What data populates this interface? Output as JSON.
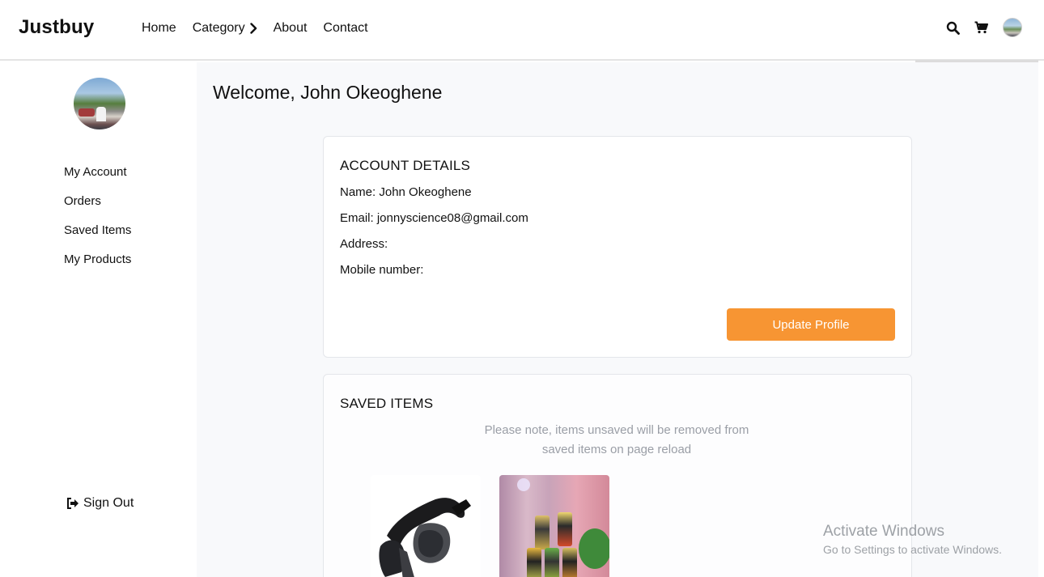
{
  "header": {
    "logo": "Justbuy",
    "nav": [
      {
        "label": "Home"
      },
      {
        "label": "Category"
      },
      {
        "label": "About"
      },
      {
        "label": "Contact"
      }
    ],
    "icons": [
      "search-icon",
      "cart-icon",
      "user-avatar"
    ]
  },
  "sidebar": {
    "items": [
      {
        "label": "My Account"
      },
      {
        "label": "Orders"
      },
      {
        "label": "Saved Items"
      },
      {
        "label": "My Products"
      }
    ],
    "signout_label": "Sign Out"
  },
  "main": {
    "welcome": "Welcome, John Okeoghene",
    "account": {
      "title": "ACCOUNT DETAILS",
      "name": "Name: John Okeoghene",
      "email": "Email: jonnyscience08@gmail.com",
      "address": "Address:",
      "mobile": "Mobile number:",
      "update_button": "Update Profile"
    },
    "saved": {
      "title": "SAVED ITEMS",
      "note_line1": "Please note, items unsaved will be removed from",
      "note_line2": "saved items on page reload",
      "items": [
        "sunglasses-image",
        "drink-cans-image"
      ]
    }
  },
  "watermark": {
    "line1": "Activate Windows",
    "line2": "Go to Settings to activate Windows."
  },
  "colors": {
    "accent": "#f79533",
    "main_bg": "#f8f9fb",
    "muted_text": "#9a9ea6"
  }
}
